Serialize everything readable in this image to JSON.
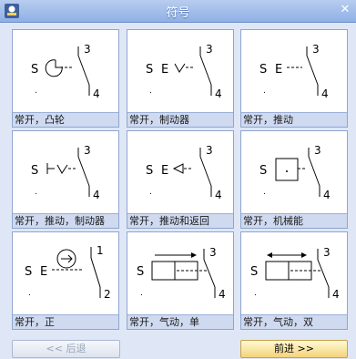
{
  "window": {
    "title": "符号",
    "close_glyph": "✕"
  },
  "symbols": [
    {
      "caption": "常开，凸轮",
      "s": "S",
      "top_num": "3",
      "bottom_num": "4"
    },
    {
      "caption": "常开，制动器",
      "s": "S",
      "e": "E",
      "top_num": "3",
      "bottom_num": "4"
    },
    {
      "caption": "常开，推动",
      "s": "S",
      "e": "E",
      "top_num": "3",
      "bottom_num": "4"
    },
    {
      "caption": "常开，推动，制动器",
      "s": "S",
      "top_num": "3",
      "bottom_num": "4"
    },
    {
      "caption": "常开，推动和返回",
      "s": "S",
      "e": "E",
      "top_num": "3",
      "bottom_num": "4"
    },
    {
      "caption": "常开，机械能",
      "s": "S",
      "top_num": "3",
      "bottom_num": "4"
    },
    {
      "caption": "常开，正",
      "s": "S",
      "e": "E",
      "top_num": "1",
      "bottom_num": "2"
    },
    {
      "caption": "常开，气动，单",
      "s": "S",
      "top_num": "3",
      "bottom_num": "4"
    },
    {
      "caption": "常开，气动，双",
      "s": "S",
      "top_num": "3",
      "bottom_num": "4"
    }
  ],
  "footer": {
    "back_label": "<< 后退",
    "next_label": "前进 >>"
  }
}
